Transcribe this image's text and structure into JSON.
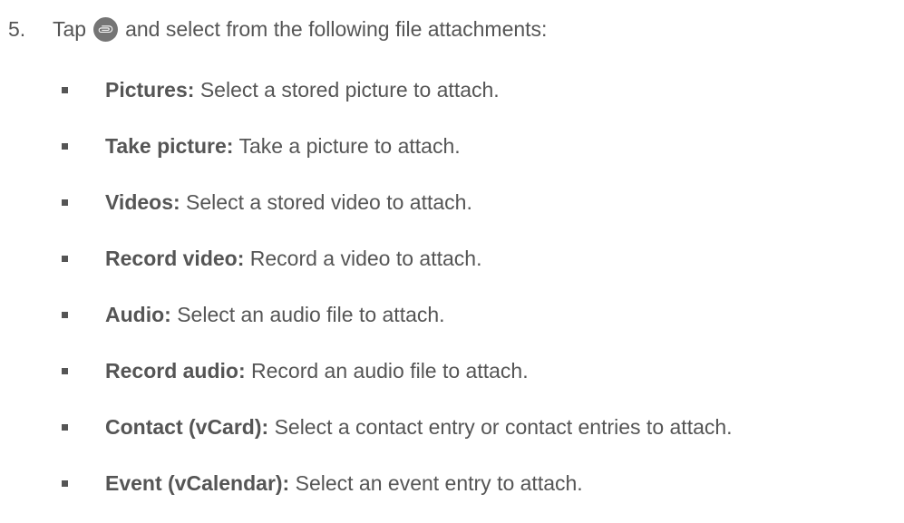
{
  "step": {
    "number": "5.",
    "text_before_icon": "Tap",
    "icon": "paperclip-icon",
    "text_after_icon": "and select from the following file attachments:"
  },
  "items": [
    {
      "term": "Pictures:",
      "description": "Select a stored picture to attach."
    },
    {
      "term": "Take picture:",
      "description": "Take a picture to attach."
    },
    {
      "term": "Videos:",
      "description": "Select a stored video to attach."
    },
    {
      "term": "Record video:",
      "description": "Record a video to attach."
    },
    {
      "term": "Audio:",
      "description": "Select an audio file to attach."
    },
    {
      "term": "Record audio:",
      "description": "Record an audio file to attach."
    },
    {
      "term": "Contact (vCard):",
      "description": "Select a contact entry or contact entries to attach."
    },
    {
      "term": "Event (vCalendar):",
      "description": "Select an event entry to attach."
    }
  ],
  "colors": {
    "text": "#555555",
    "icon_background": "#757575",
    "icon_foreground": "#ffffff"
  }
}
